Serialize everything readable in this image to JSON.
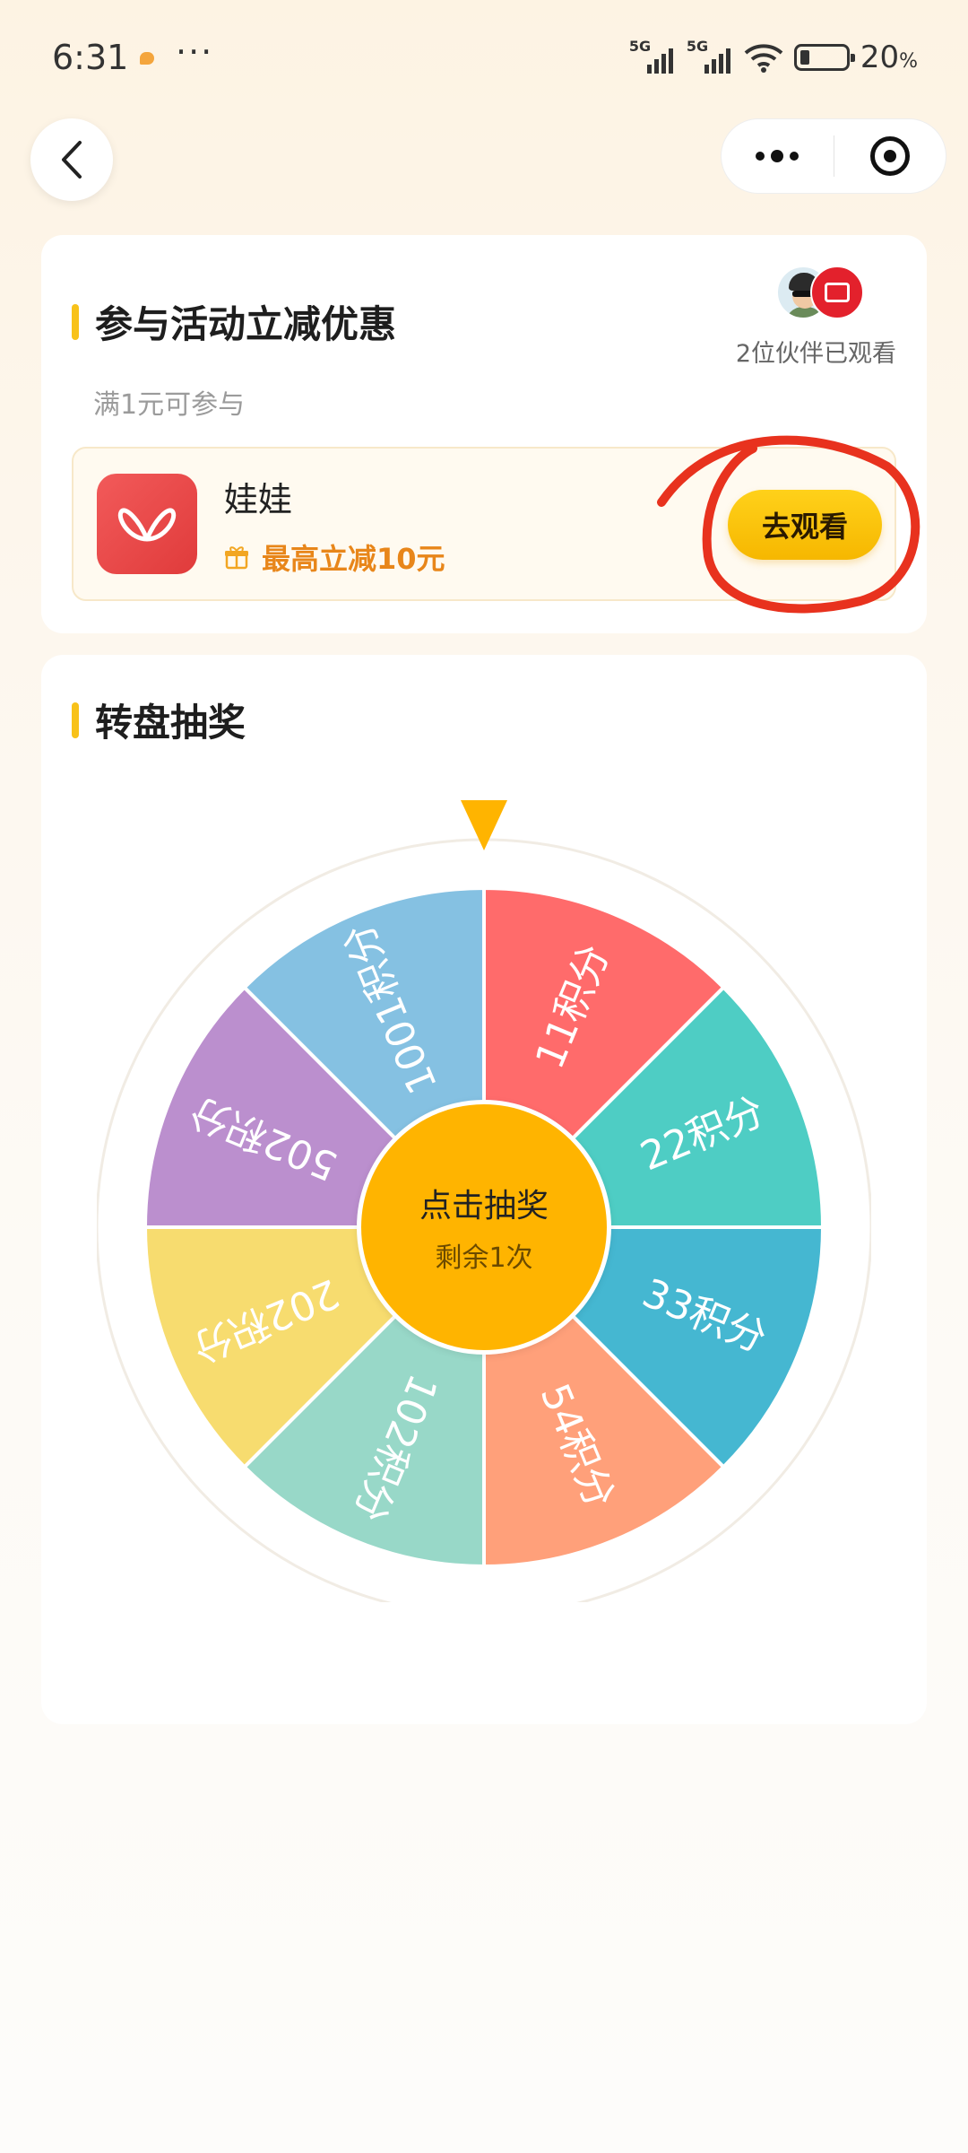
{
  "status_bar": {
    "time": "6:31",
    "more": "···",
    "network1": "5G",
    "network2": "5G",
    "battery": "20",
    "battery_unit": "%",
    "battery_level": 0.2
  },
  "section_activity": {
    "title": "参与活动立减优惠",
    "partners_text": "2位伙伴已观看",
    "min_requirement": "满1元可参与",
    "offer": {
      "app_name": "娃娃",
      "discount_text": "最高立减10元",
      "button_label": "去观看"
    }
  },
  "section_wheel": {
    "title": "转盘抽奖",
    "center_label": "点击抽奖",
    "remaining": "剩余1次",
    "segments": [
      {
        "label": "11积分",
        "color": "#ff6b6b"
      },
      {
        "label": "22积分",
        "color": "#4ecdc4"
      },
      {
        "label": "33积分",
        "color": "#45b7d1"
      },
      {
        "label": "54积分",
        "color": "#ffa07a"
      },
      {
        "label": "102积分",
        "color": "#98d8c8"
      },
      {
        "label": "202积分",
        "color": "#f7dc6f"
      },
      {
        "label": "502积分",
        "color": "#bb8fce"
      },
      {
        "label": "1001积分",
        "color": "#85c1e2"
      }
    ],
    "pointer_color": "#ffb400"
  },
  "annotation_color": "#e8321e"
}
